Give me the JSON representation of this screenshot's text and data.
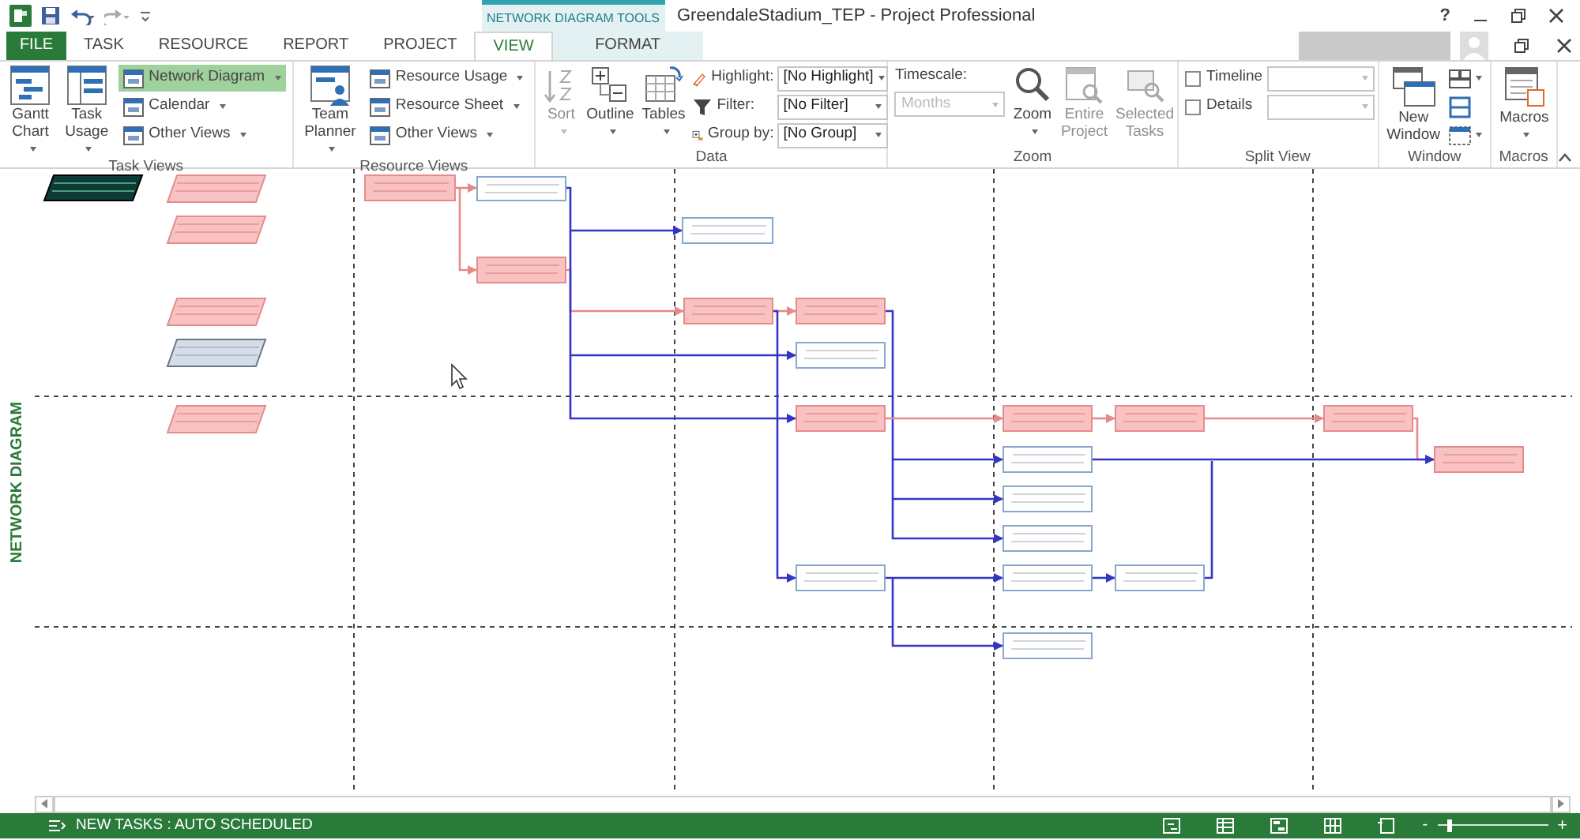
{
  "title_bar": {
    "context_group": "NETWORK DIAGRAM TOOLS",
    "title": "GreendaleStadium_TEP - Project Professional",
    "help": "?"
  },
  "tabs": [
    {
      "label": "FILE",
      "kind": "file",
      "selected": false
    },
    {
      "label": "TASK",
      "kind": "tab",
      "selected": false
    },
    {
      "label": "RESOURCE",
      "kind": "tab",
      "selected": false
    },
    {
      "label": "REPORT",
      "kind": "tab",
      "selected": false
    },
    {
      "label": "PROJECT",
      "kind": "tab",
      "selected": false
    },
    {
      "label": "VIEW",
      "kind": "tab",
      "selected": true
    },
    {
      "label": "FORMAT",
      "kind": "contextual",
      "selected": false
    }
  ],
  "ribbon_groups": [
    {
      "title": "Task Views",
      "columns": [
        [
          {
            "kind": "large",
            "label": "Gantt\nChart",
            "dropdown": true,
            "disabled": false
          }
        ],
        [
          {
            "kind": "large",
            "label": "Task\nUsage",
            "dropdown": true,
            "disabled": false
          }
        ],
        [
          {
            "kind": "small",
            "label": "Network Diagram",
            "dropdown": true,
            "selected": true
          },
          {
            "kind": "small",
            "label": "Calendar",
            "dropdown": true,
            "selected": false
          },
          {
            "kind": "small",
            "label": "Other Views",
            "dropdown": true,
            "selected": false
          }
        ]
      ]
    },
    {
      "title": "Resource Views",
      "columns": [
        [
          {
            "kind": "large",
            "label": "Team\nPlanner",
            "dropdown": true,
            "disabled": false
          }
        ],
        [
          {
            "kind": "small",
            "label": "Resource Usage",
            "dropdown": true,
            "selected": false
          },
          {
            "kind": "small",
            "label": "Resource Sheet",
            "dropdown": true,
            "selected": false
          },
          {
            "kind": "small",
            "label": "Other Views",
            "dropdown": true,
            "selected": false
          }
        ]
      ]
    },
    {
      "title": "Data",
      "columns": [
        [
          {
            "kind": "large",
            "label": "Sort\n",
            "dropdown": true,
            "disabled": true
          }
        ],
        [
          {
            "kind": "large",
            "label": "Outline\n",
            "dropdown": true,
            "disabled": false
          }
        ],
        [
          {
            "kind": "large",
            "label": "Tables\n",
            "dropdown": true,
            "disabled": false
          }
        ],
        [
          {
            "kind": "field",
            "label": "Highlight:",
            "value": "[No Highlight]",
            "disabled": false
          },
          {
            "kind": "field",
            "label": "Filter:",
            "value": "[No Filter]",
            "disabled": false
          },
          {
            "kind": "field",
            "label": "Group by:",
            "value": "[No Group]",
            "disabled": false
          }
        ]
      ]
    },
    {
      "title": "Zoom",
      "columns": [
        [
          {
            "kind": "stacked-field",
            "label": "Timescale:",
            "value": "Months",
            "disabled": true
          }
        ],
        [
          {
            "kind": "large",
            "label": "Zoom\n",
            "dropdown": true,
            "disabled": false
          }
        ],
        [
          {
            "kind": "large",
            "label": "Entire\nProject",
            "dropdown": false,
            "disabled": true
          }
        ],
        [
          {
            "kind": "large",
            "label": "Selected\nTasks",
            "dropdown": false,
            "disabled": true
          }
        ]
      ]
    },
    {
      "title": "Split View",
      "columns": [
        [
          {
            "kind": "check",
            "label": "Timeline",
            "checked": false
          },
          {
            "kind": "check",
            "label": "Details",
            "checked": false
          }
        ],
        [
          {
            "kind": "combo",
            "disabled": true
          },
          {
            "kind": "combo",
            "disabled": true
          }
        ]
      ]
    },
    {
      "title": "Window",
      "columns": [
        [
          {
            "kind": "large",
            "label": "New\nWindow",
            "dropdown": false,
            "disabled": false
          }
        ],
        [
          {
            "kind": "icon",
            "dropdown": true
          },
          {
            "kind": "icon",
            "dropdown": false
          },
          {
            "kind": "icon",
            "dropdown": true
          }
        ]
      ]
    },
    {
      "title": "Macros",
      "columns": [
        [
          {
            "kind": "large",
            "label": "Macros\n",
            "dropdown": true,
            "disabled": false
          }
        ]
      ]
    }
  ],
  "view_label": "NETWORK DIAGRAM",
  "nodes": [
    {
      "kind": "summary",
      "critical": false,
      "selected": true
    },
    {
      "kind": "summary",
      "critical": true,
      "selected": false
    },
    {
      "kind": "summary",
      "critical": true,
      "selected": false
    },
    {
      "kind": "summary",
      "critical": true,
      "selected": false
    },
    {
      "kind": "summary",
      "critical": false,
      "selected": false
    },
    {
      "kind": "summary",
      "critical": true,
      "selected": false
    },
    {
      "kind": "task",
      "critical": true,
      "selected": false
    },
    {
      "kind": "task",
      "critical": false,
      "selected": false
    },
    {
      "kind": "task",
      "critical": true,
      "selected": false
    },
    {
      "kind": "task",
      "critical": false,
      "selected": false
    },
    {
      "kind": "task",
      "critical": true,
      "selected": false
    },
    {
      "kind": "task",
      "critical": true,
      "selected": false
    },
    {
      "kind": "task",
      "critical": false,
      "selected": false
    },
    {
      "kind": "task",
      "critical": true,
      "selected": false
    },
    {
      "kind": "task",
      "critical": true,
      "selected": false
    },
    {
      "kind": "task",
      "critical": true,
      "selected": false
    },
    {
      "kind": "task",
      "critical": true,
      "selected": false
    },
    {
      "kind": "task",
      "critical": true,
      "selected": false
    },
    {
      "kind": "task",
      "critical": false,
      "selected": false
    },
    {
      "kind": "task",
      "critical": false,
      "selected": false
    },
    {
      "kind": "task",
      "critical": false,
      "selected": false
    },
    {
      "kind": "task",
      "critical": false,
      "selected": false
    },
    {
      "kind": "task",
      "critical": false,
      "selected": false
    },
    {
      "kind": "task",
      "critical": false,
      "selected": false
    },
    {
      "kind": "task",
      "critical": false,
      "selected": false
    }
  ],
  "links": [
    {
      "critical": true
    },
    {
      "critical": true
    },
    {
      "critical": true
    },
    {
      "critical": true
    },
    {
      "critical": false
    },
    {
      "critical": false
    },
    {
      "critical": false
    },
    {
      "critical": false
    },
    {
      "critical": false
    },
    {
      "critical": false
    },
    {
      "critical": false
    },
    {
      "critical": true
    },
    {
      "critical": true
    },
    {
      "critical": true
    },
    {
      "critical": true
    },
    {
      "critical": false
    },
    {
      "critical": false
    },
    {
      "critical": false
    },
    {
      "critical": false
    },
    {
      "critical": false
    }
  ],
  "status_bar": {
    "text": "NEW TASKS : AUTO SCHEDULED",
    "zoom_out": "-",
    "zoom_in": "+",
    "zoom": {
      "level": 0.1
    }
  }
}
